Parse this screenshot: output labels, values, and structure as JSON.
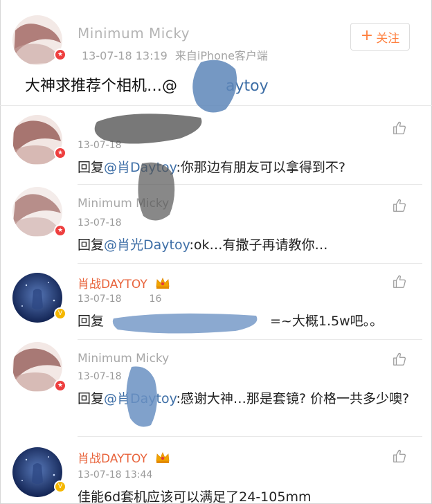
{
  "post": {
    "user_name": "Minimum Micky",
    "timestamp": "13-07-18 13:19",
    "source": "来自iPhone客户端",
    "follow_label": "关注",
    "text_prefix": "大神求推荐个相机…@",
    "text_mention_tail": "aytoy"
  },
  "comments": [
    {
      "name": "",
      "time": "13-07-18",
      "text_prefix": "回复",
      "mention": "@肖Daytoy",
      "text_rest": ":你那边有朋友可以拿得到不?"
    },
    {
      "name": "Minimum Micky",
      "time": "13-07-18",
      "text_prefix": "回复",
      "mention": "@肖光Daytoy",
      "text_rest": ":ok…有撒子再请教你…"
    },
    {
      "name": "肖战DAYTOY",
      "time": "13-07-18",
      "time_tail": "16",
      "text_prefix": "回复",
      "text_rest": "=~大概1.5w吧。。"
    },
    {
      "name": "Minimum Micky",
      "time": "13-07-18",
      "text_prefix": "回复",
      "mention": "@肖Daytoy",
      "text_rest": ":感谢大神…那是套镜? 价格一共多少噢?"
    },
    {
      "name": "肖战DAYTOY",
      "time": "13-07-18 13:44",
      "text_rest": "佳能6d套机应该可以满足了24-105mm"
    }
  ],
  "colors": {
    "vip_name": "#e8633b",
    "follow_accent": "#ff8140",
    "mention": "#3d6ea6"
  },
  "icons": [
    "thumbs-up-icon",
    "crown-icon",
    "verified-v-icon",
    "weibo-badge-icon"
  ]
}
